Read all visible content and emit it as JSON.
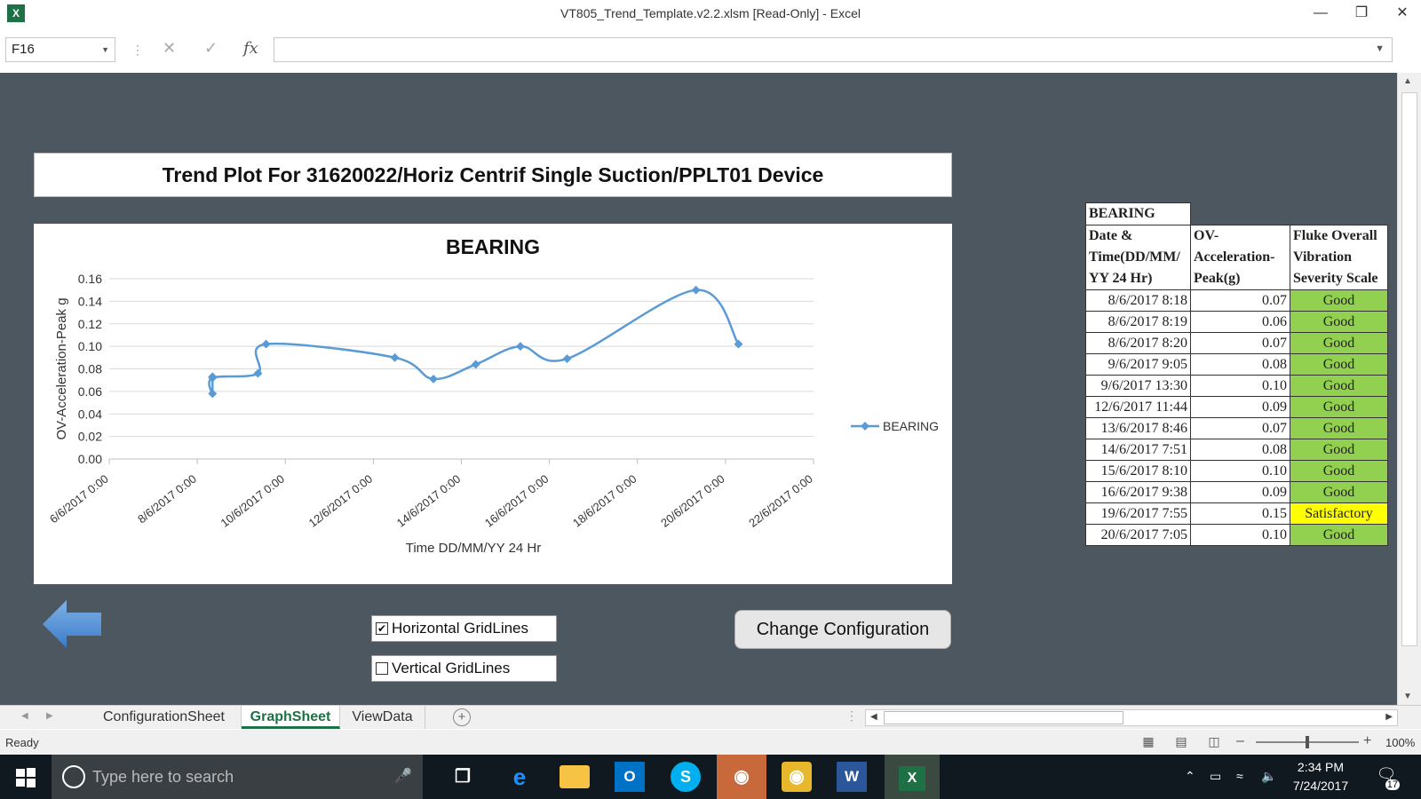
{
  "window": {
    "title": "VT805_Trend_Template.v2.2.xlsm  [Read-Only] - Excel",
    "app_icon_letter": "X"
  },
  "formula_bar": {
    "name_box": "F16",
    "fx_label": "fx",
    "formula": ""
  },
  "sheet": {
    "plot_title": "Trend Plot For 31620022/Horiz Centrif Single Suction/PPLT01 Device",
    "checkbox_horizontal": {
      "label": "Horizontal GridLines",
      "checked": true
    },
    "checkbox_vertical": {
      "label": "Vertical GridLines",
      "checked": false
    },
    "change_button": "Change Configuration"
  },
  "chart_data": {
    "type": "line",
    "title": "BEARING",
    "xlabel": "Time   DD/MM/YY 24 Hr",
    "ylabel": "OV-Acceleration-Peak  g",
    "ylim": [
      0,
      0.16
    ],
    "y_ticks": [
      "0.00",
      "0.02",
      "0.04",
      "0.06",
      "0.08",
      "0.10",
      "0.12",
      "0.14",
      "0.16"
    ],
    "x_ticks": [
      "6/6/2017 0:00",
      "8/6/2017 0:00",
      "10/6/2017 0:00",
      "12/6/2017 0:00",
      "14/6/2017 0:00",
      "16/6/2017 0:00",
      "18/6/2017 0:00",
      "20/6/2017 0:00",
      "22/6/2017 0:00"
    ],
    "xlim": [
      "6/6/2017 0:00",
      "22/6/2017 0:00"
    ],
    "grid_horizontal": true,
    "grid_vertical": false,
    "legend": "right",
    "line_color": "#5b9bd5",
    "series": [
      {
        "name": "BEARING",
        "x": [
          "8/6/2017 8:18",
          "8/6/2017 8:19",
          "8/6/2017 8:20",
          "9/6/2017 9:05",
          "9/6/2017 13:30",
          "12/6/2017 11:44",
          "13/6/2017 8:46",
          "14/6/2017 7:51",
          "15/6/2017 8:10",
          "16/6/2017 9:38",
          "19/6/2017 7:55",
          "20/6/2017 7:05"
        ],
        "values": [
          0.073,
          0.058,
          0.072,
          0.076,
          0.102,
          0.09,
          0.071,
          0.084,
          0.1,
          0.089,
          0.15,
          0.102
        ]
      }
    ]
  },
  "data_table": {
    "title": "BEARING",
    "headers": [
      "Date & Time(DD/MM/ YY 24 Hr)",
      "OV- Acceleration- Peak(g)",
      "Fluke Overall Vibration Severity Scale"
    ],
    "header_lines": [
      [
        "Date &",
        "Time(DD/MM/",
        "YY 24 Hr)"
      ],
      [
        "OV-",
        "Acceleration-",
        "Peak(g)"
      ],
      [
        "Fluke Overall",
        "Vibration",
        "Severity Scale"
      ]
    ],
    "rows": [
      {
        "date": "8/6/2017 8:18",
        "value": "0.07",
        "severity": "Good"
      },
      {
        "date": "8/6/2017 8:19",
        "value": "0.06",
        "severity": "Good"
      },
      {
        "date": "8/6/2017 8:20",
        "value": "0.07",
        "severity": "Good"
      },
      {
        "date": "9/6/2017 9:05",
        "value": "0.08",
        "severity": "Good"
      },
      {
        "date": "9/6/2017 13:30",
        "value": "0.10",
        "severity": "Good"
      },
      {
        "date": "12/6/2017 11:44",
        "value": "0.09",
        "severity": "Good"
      },
      {
        "date": "13/6/2017 8:46",
        "value": "0.07",
        "severity": "Good"
      },
      {
        "date": "14/6/2017 7:51",
        "value": "0.08",
        "severity": "Good"
      },
      {
        "date": "15/6/2017 8:10",
        "value": "0.10",
        "severity": "Good"
      },
      {
        "date": "16/6/2017 9:38",
        "value": "0.09",
        "severity": "Good"
      },
      {
        "date": "19/6/2017 7:55",
        "value": "0.15",
        "severity": "Satisfactory"
      },
      {
        "date": "20/6/2017 7:05",
        "value": "0.10",
        "severity": "Good"
      }
    ],
    "colors": {
      "Good": "#92d050",
      "Satisfactory": "#ffff00"
    }
  },
  "tabs": [
    {
      "label": "ConfigurationSheet",
      "active": false
    },
    {
      "label": "GraphSheet",
      "active": true
    },
    {
      "label": "ViewData",
      "active": false
    }
  ],
  "status": {
    "ready": "Ready",
    "zoom": "100%"
  },
  "taskbar": {
    "search_placeholder": "Type here to search",
    "time": "2:34 PM",
    "date": "7/24/2017",
    "notification_count": "17",
    "apps": [
      "task-view",
      "edge",
      "file-explorer",
      "outlook",
      "skype",
      "app",
      "camera",
      "word",
      "excel"
    ]
  }
}
